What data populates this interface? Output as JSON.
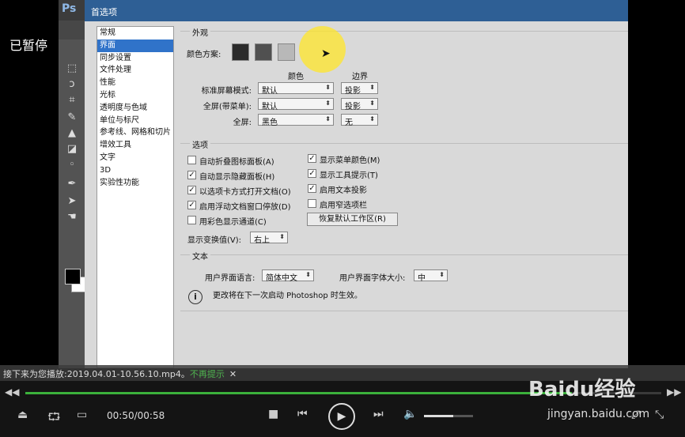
{
  "player": {
    "paused_label": "已暂停",
    "next_up_text": "接下来为您播放:2019.04.01-10.56.10.mp4。",
    "next_up_link": "不再提示",
    "time": "00:50/00:58",
    "progress": 0.86,
    "volume": 0.6,
    "watermark_logo": "Baidu经验",
    "watermark_url": "jingyan.baidu.com"
  },
  "app": {
    "logo": "Ps"
  },
  "dialog": {
    "title": "首选项",
    "nav": [
      "常规",
      "界面",
      "同步设置",
      "文件处理",
      "性能",
      "光标",
      "透明度与色域",
      "单位与标尺",
      "参考线、网格和切片",
      "增效工具",
      "文字",
      "3D",
      "实验性功能"
    ],
    "nav_selected_index": 1,
    "appearance": {
      "title": "外观",
      "color_scheme_label": "颜色方案:",
      "swatch_colors": [
        "#2b2b2b",
        "#505050",
        "#b8b8b8"
      ],
      "col_color": "颜色",
      "col_border": "边界",
      "rows": [
        {
          "label": "标准屏幕模式:",
          "color": "默认",
          "border": "投影"
        },
        {
          "label": "全屏(带菜单):",
          "color": "默认",
          "border": "投影"
        },
        {
          "label": "全屏:",
          "color": "黑色",
          "border": "无"
        }
      ]
    },
    "options": {
      "title": "选项",
      "left": [
        {
          "label": "自动折叠图标面板(A)",
          "checked": false
        },
        {
          "label": "自动显示隐藏面板(H)",
          "checked": true
        },
        {
          "label": "以选项卡方式打开文档(O)",
          "checked": true
        },
        {
          "label": "启用浮动文档窗口停放(D)",
          "checked": true
        },
        {
          "label": "用彩色显示通道(C)",
          "checked": false
        }
      ],
      "right": [
        {
          "label": "显示菜单颜色(M)",
          "checked": true
        },
        {
          "label": "显示工具提示(T)",
          "checked": true
        },
        {
          "label": "启用文本投影",
          "checked": true
        },
        {
          "label": "启用窄选项栏",
          "checked": false
        }
      ],
      "reset_button": "恢复默认工作区(R)",
      "transform_label": "显示变换值(V):",
      "transform_value": "右上"
    },
    "text": {
      "title": "文本",
      "lang_label": "用户界面语言:",
      "lang_value": "简体中文",
      "size_label": "用户界面字体大小:",
      "size_value": "中",
      "info": "更改将在下一次启动 Photoshop 时生效。"
    }
  }
}
